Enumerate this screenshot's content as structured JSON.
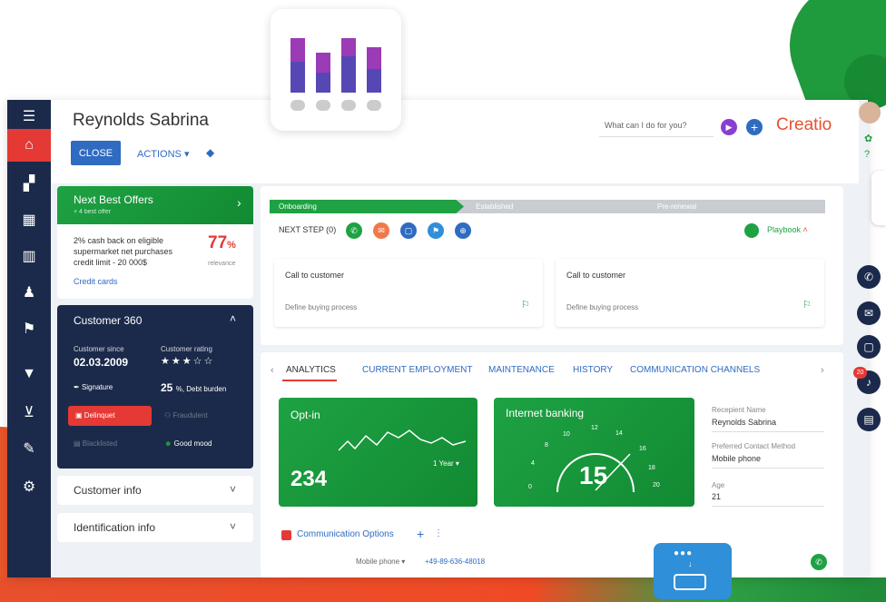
{
  "header": {
    "contact_name": "Reynolds Sabrina",
    "close_label": "CLOSE",
    "actions_label": "ACTIONS",
    "search_placeholder": "What can I do for you?",
    "brand": "Creatio"
  },
  "nbo": {
    "title": "Next Best Offers",
    "subtitle": "+ 4 best offer",
    "offer_text_1": "2% cash back on eligible",
    "offer_text_2": "supermarket net purchases",
    "offer_text_3": "credit limit - 20 000$",
    "relevance_value": "77",
    "relevance_unit": "%",
    "relevance_label": "relevance",
    "category": "Credit cards"
  },
  "c360": {
    "title": "Customer 360",
    "since_label": "Customer since",
    "since_value": "02.03.2009",
    "rating_label": "Customer rating",
    "rating_stars": 3,
    "signature": "Signature",
    "debt_value": "25",
    "debt_label": "%, Debt burden",
    "delinquent": "Delinquet",
    "fraudulent": "Fraudulent",
    "blacklisted": "Blacklisted",
    "mood": "Good mood"
  },
  "sections": {
    "customer_info": "Customer info",
    "identification_info": "Identification info"
  },
  "stages": {
    "s1": "Onboarding",
    "s2": "Established",
    "s3": "Pre-renewal"
  },
  "next_step": {
    "label": "NEXT STEP (0)",
    "playbook": "Playbook"
  },
  "tasks": [
    {
      "title": "Call to customer",
      "subtitle": "Define buying process"
    },
    {
      "title": "Call to customer",
      "subtitle": "Define buying process"
    }
  ],
  "tabs": [
    "ANALYTICS",
    "CURRENT EMPLOYMENT",
    "MAINTENANCE",
    "HISTORY",
    "COMMUNICATION CHANNELS"
  ],
  "optin": {
    "title": "Opt-in",
    "value": "234",
    "period": "1 Year"
  },
  "banking": {
    "title": "Internet banking",
    "value": "15",
    "ticks": [
      "0",
      "4",
      "8",
      "10",
      "12",
      "14",
      "16",
      "18",
      "20"
    ]
  },
  "details": {
    "recipient_label": "Recepient Name",
    "recipient_value": "Reynolds Sabrina",
    "contact_method_label": "Preferred Contact Method",
    "contact_method_value": "Mobile phone",
    "age_label": "Age",
    "age_value": "21"
  },
  "comm": {
    "title": "Communication Options",
    "type": "Mobile phone",
    "number": "+49-89-636-48018"
  },
  "notifications_count": "20",
  "colors": {
    "sidebar": "#1b2a4a",
    "accent_red": "#e53935",
    "green": "#1ea243",
    "blue": "#2f6bc1"
  }
}
